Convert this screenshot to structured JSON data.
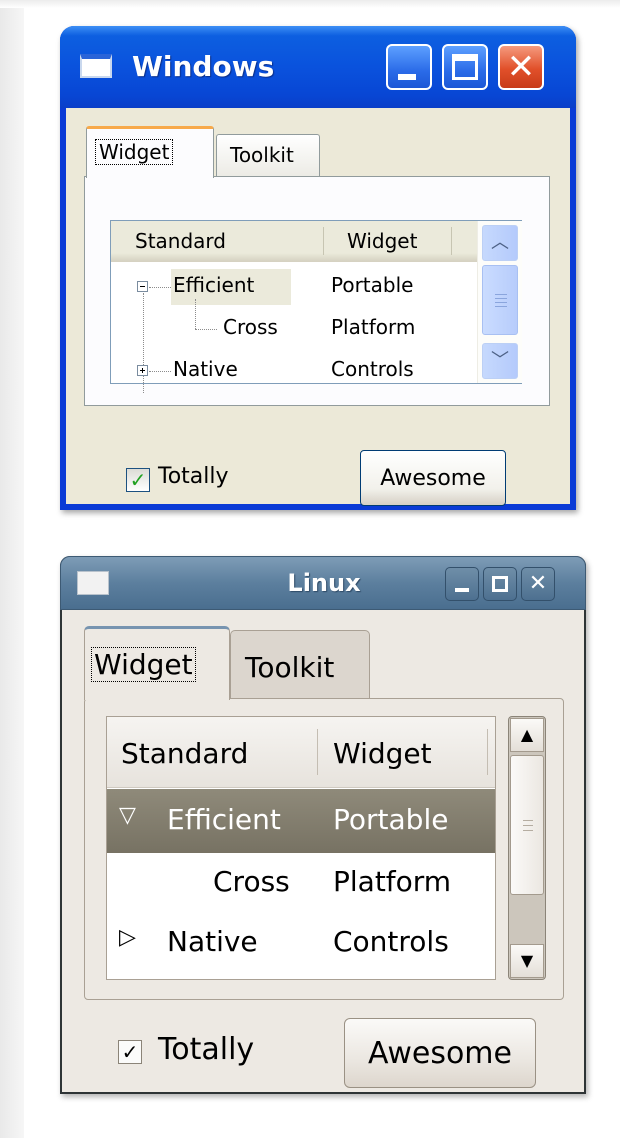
{
  "windows": {
    "title": "Windows",
    "tabs": [
      "Widget",
      "Toolkit"
    ],
    "columns": [
      "Standard",
      "Widget"
    ],
    "rows": [
      {
        "standard": "Efficient",
        "widget": "Portable"
      },
      {
        "standard": "Cross",
        "widget": "Platform"
      },
      {
        "standard": "Native",
        "widget": "Controls"
      }
    ],
    "checkbox_label": "Totally",
    "checkbox_checked": true,
    "button_label": "Awesome"
  },
  "linux": {
    "title": "Linux",
    "tabs": [
      "Widget",
      "Toolkit"
    ],
    "columns": [
      "Standard",
      "Widget"
    ],
    "rows": [
      {
        "standard": "Efficient",
        "widget": "Portable"
      },
      {
        "standard": "Cross",
        "widget": "Platform"
      },
      {
        "standard": "Native",
        "widget": "Controls"
      }
    ],
    "checkbox_label": "Totally",
    "checkbox_checked": true,
    "button_label": "Awesome"
  },
  "icons": {
    "app": "window-icon",
    "minimize": "minimize-icon",
    "maximize": "maximize-icon",
    "close": "close-icon",
    "check": "checkmark-icon",
    "collapse": "tree-collapse-icon",
    "expand": "tree-expand-icon",
    "scroll_up": "arrow-up-icon",
    "scroll_down": "arrow-down-icon"
  },
  "colors": {
    "xp_title_blue": "#0a52dd",
    "xp_close_red": "#e1502a",
    "xp_tab_accent": "#f7a94a",
    "linux_title_blue": "#5c7f9e",
    "linux_selection": "#827d6e"
  }
}
